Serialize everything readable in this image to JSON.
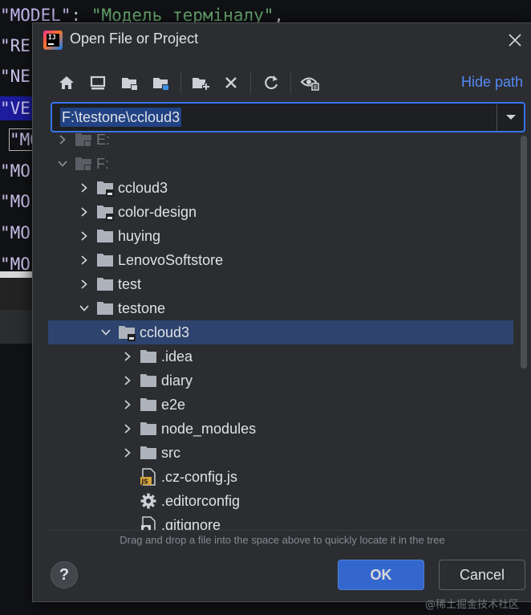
{
  "editor": {
    "line0": {
      "key": "\"MODEL\"",
      "punc1": ": ",
      "str": "\"Модель терміналу\"",
      "punc2": ","
    },
    "lines": [
      "\"RE",
      "\"NE",
      "\"VE",
      "\"MO",
      "\"MO",
      "\"MO",
      "\"MO",
      "\"MO"
    ]
  },
  "dialog": {
    "title": "Open File or Project",
    "hide_path_label": "Hide path",
    "path_value": "F:\\testone\\ccloud3",
    "hint": "Drag and drop a file into the space above to quickly locate it in the tree",
    "ok_label": "OK",
    "cancel_label": "Cancel",
    "help_label": "?"
  },
  "toolbar": {
    "icons": [
      "home-icon",
      "desktop-icon",
      "project-folder-icon",
      "module-folder-icon",
      "new-folder-icon",
      "delete-icon",
      "refresh-icon",
      "show-hidden-icon"
    ]
  },
  "tree": {
    "rows": [
      {
        "label": "E:",
        "depth": 0,
        "expanded": false,
        "kind": "drive",
        "dim": true
      },
      {
        "label": "F:",
        "depth": 0,
        "expanded": true,
        "kind": "drive",
        "dim": true
      },
      {
        "label": "ccloud3",
        "depth": 1,
        "expanded": false,
        "kind": "project-folder"
      },
      {
        "label": "color-design",
        "depth": 1,
        "expanded": false,
        "kind": "project-folder"
      },
      {
        "label": "huying",
        "depth": 1,
        "expanded": false,
        "kind": "folder"
      },
      {
        "label": "LenovoSoftstore",
        "depth": 1,
        "expanded": false,
        "kind": "folder"
      },
      {
        "label": "test",
        "depth": 1,
        "expanded": false,
        "kind": "folder"
      },
      {
        "label": "testone",
        "depth": 1,
        "expanded": true,
        "kind": "folder"
      },
      {
        "label": "ccloud3",
        "depth": 2,
        "expanded": true,
        "kind": "project-folder",
        "selected": true
      },
      {
        "label": ".idea",
        "depth": 3,
        "expanded": false,
        "kind": "folder"
      },
      {
        "label": "diary",
        "depth": 3,
        "expanded": false,
        "kind": "folder"
      },
      {
        "label": "e2e",
        "depth": 3,
        "expanded": false,
        "kind": "folder"
      },
      {
        "label": "node_modules",
        "depth": 3,
        "expanded": false,
        "kind": "folder"
      },
      {
        "label": "src",
        "depth": 3,
        "expanded": false,
        "kind": "folder"
      },
      {
        "label": ".cz-config.js",
        "depth": 3,
        "expanded": null,
        "kind": "js-file"
      },
      {
        "label": ".editorconfig",
        "depth": 3,
        "expanded": null,
        "kind": "config-file"
      },
      {
        "label": ".gitignore",
        "depth": 3,
        "expanded": null,
        "kind": "ignore-file"
      }
    ]
  },
  "watermark": "@稀土掘金技术社区",
  "colors": {
    "accent": "#3574f0",
    "link": "#548af7",
    "selection": "#2e436e",
    "folder": "#aeb3bb",
    "js_badge": "#d2a23a",
    "dialog_bg": "#2b2d30"
  }
}
